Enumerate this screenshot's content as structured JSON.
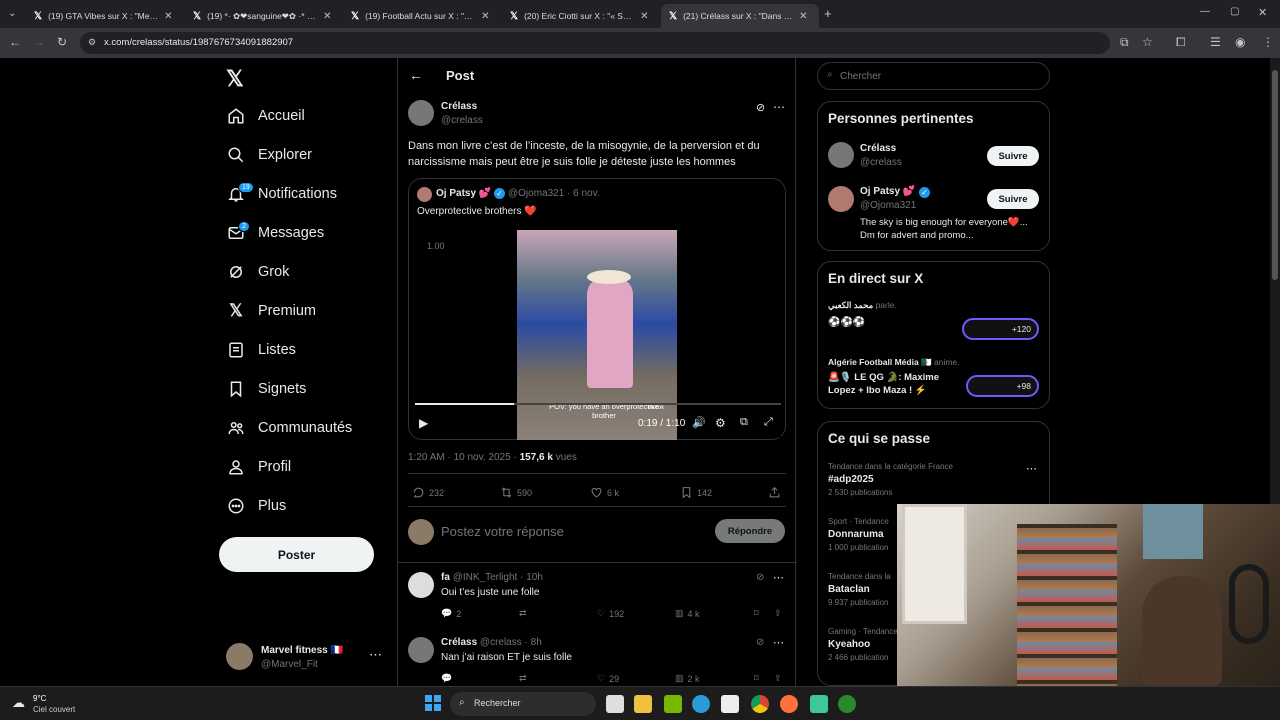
{
  "browser": {
    "tabs": [
      {
        "label": "(19) GTA Vibes sur X : \"Merci. G"
      },
      {
        "label": "(19) *· ✿❤sanguine❤✿ ·* (@"
      },
      {
        "label": "(19) Football Actu sur X : \"Luca"
      },
      {
        "label": "(20) Eric Ciotti sur X : \"« Sale gu"
      },
      {
        "label": "(21) Crélass sur X : \"Dans mon l"
      }
    ],
    "url": "x.com/crelass/status/1987676734091882907"
  },
  "sidebar": {
    "items": [
      {
        "label": "Accueil"
      },
      {
        "label": "Explorer"
      },
      {
        "label": "Notifications",
        "badge": "19"
      },
      {
        "label": "Messages",
        "badge": "2"
      },
      {
        "label": "Grok"
      },
      {
        "label": "Premium"
      },
      {
        "label": "Listes"
      },
      {
        "label": "Signets"
      },
      {
        "label": "Communautés"
      },
      {
        "label": "Profil"
      },
      {
        "label": "Plus"
      }
    ],
    "post_button": "Poster",
    "account": {
      "name": "Marvel fitness 🇫🇷",
      "handle": "@Marvel_Fit"
    }
  },
  "main": {
    "header": "Post",
    "author": {
      "name": "Crélass",
      "handle": "@crelass"
    },
    "text": "Dans mon livre c’est de l’inceste, de la misogynie, de la perversion et du narcissisme mais peut être je suis folle je déteste juste les hommes",
    "quote": {
      "name": "Oj Patsy 💕",
      "handle": "@Ojoma321",
      "date": "· 6 nov.",
      "text": "Overprotective brothers ❤️",
      "video": {
        "speed": "1.00",
        "caption": "POV: you have an overprotective brother",
        "watermark": "TikTok",
        "time": "0:19 / 1:10",
        "progress": 0.27
      }
    },
    "meta": {
      "time": "1:20 AM · 10 nov. 2025 · ",
      "views": "157,6 k",
      "views_suffix": " vues"
    },
    "stats": {
      "replies": "232",
      "reposts": "590",
      "likes": "6 k",
      "bookmarks": "142"
    },
    "reply_placeholder": "Postez votre réponse",
    "reply_button": "Répondre",
    "replies": [
      {
        "name": "fa",
        "handle": "@INK_Terlight",
        "time": "· 10h",
        "text": "Oui t’es juste une folle",
        "replies": "2",
        "likes": "192",
        "views": "4 k"
      },
      {
        "name": "Crélass",
        "handle": "@crelass",
        "time": "· 8h",
        "text": "Nan j’ai raison ET je suis folle",
        "likes": "29",
        "views": "2 k"
      }
    ]
  },
  "right": {
    "search_placeholder": "Chercher",
    "relevant": {
      "title": "Personnes pertinentes",
      "people": [
        {
          "name": "Crélass",
          "handle": "@crelass",
          "button": "Suivre"
        },
        {
          "name": "Oj Patsy 💕",
          "handle": "@Ojoma321",
          "button": "Suivre",
          "bio": "The sky is big enough for everyone❤️... Dm for advert and promo..."
        }
      ]
    },
    "live": {
      "title": "En direct sur X",
      "items": [
        {
          "host": "محمد الكعبي",
          "verb": "parle.",
          "title": "⚽⚽⚽",
          "count": "+120"
        },
        {
          "host": "Algérie Football Média 🇩🇿",
          "verb": "anime.",
          "title": "🚨🎙️ LE QG 🐊: Maxime Lopez + Ibo Maza ! ⚡",
          "count": "+98"
        }
      ]
    },
    "trends": {
      "title": "Ce qui se passe",
      "items": [
        {
          "cat": "Tendance dans la catégorie France",
          "name": "#adp2025",
          "count": "2 530 publications"
        },
        {
          "cat": "Sport · Tendance",
          "name": "Donnaruma",
          "count": "1 000 publication"
        },
        {
          "cat": "Tendance dans la",
          "name": "Bataclan",
          "count": "9 937 publication"
        },
        {
          "cat": "Gaming · Tendance",
          "name": "Kyeahoo",
          "count": "2 466 publication"
        }
      ]
    }
  },
  "taskbar": {
    "weather_temp": "9°C",
    "weather_desc": "Ciel couvert",
    "search": "Rechercher"
  },
  "colors": {
    "accent": "#1d9bf0",
    "like": "#f91880",
    "bg": "#000000",
    "border": "#2f3336"
  }
}
